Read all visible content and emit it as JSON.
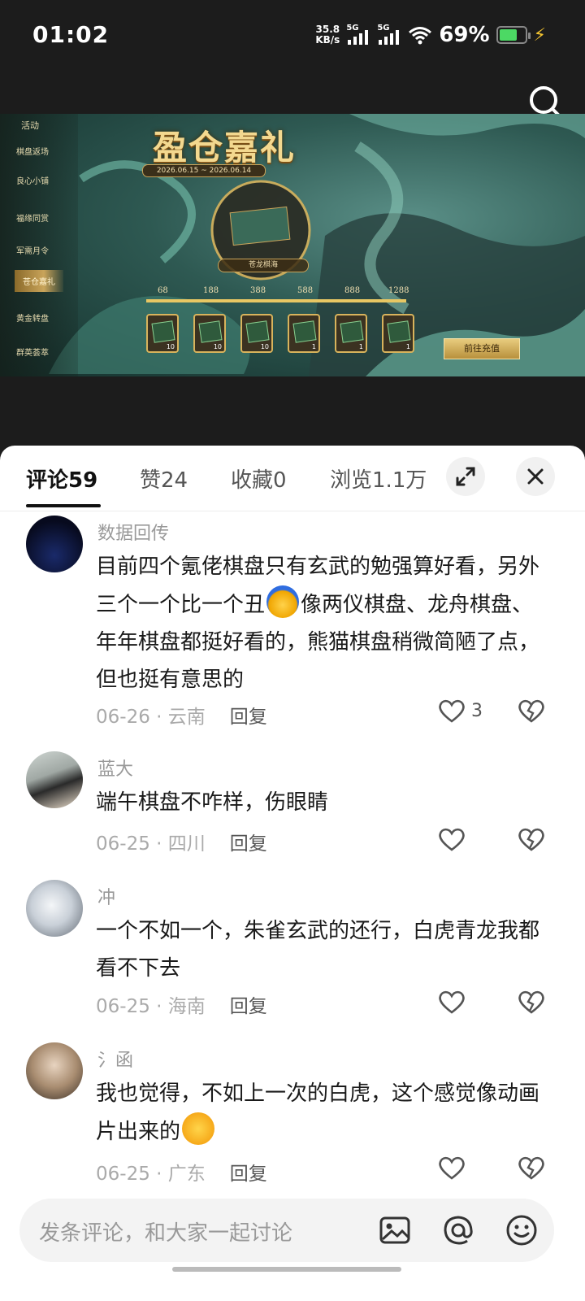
{
  "status_bar": {
    "time": "01:02",
    "net_speed_value": "35.8",
    "net_speed_unit": "KB/s",
    "sim1": "5G",
    "sim2": "5G",
    "battery": "69%",
    "battery_level": 0.69,
    "battery_color": "#4cd964"
  },
  "banner": {
    "menu_title": "活动",
    "menu_items": [
      "棋盘返场",
      "良心小铺",
      "福缘同赏",
      "军需月令",
      "苍仓嘉礼",
      "黄金转盘",
      "群英荟萃"
    ],
    "event_title": "盈仓嘉礼",
    "event_date": "2026.06.15 ~ 2026.06.14",
    "prize_name": "苍龙棋海",
    "milestones": [
      "68",
      "188",
      "388",
      "588",
      "888",
      "1288"
    ],
    "reward_counts": [
      "10",
      "10",
      "10",
      "1",
      "1",
      "1"
    ],
    "recharge_button": "前往充值"
  },
  "tabs": [
    {
      "label": "评论",
      "count": "59"
    },
    {
      "label": "赞",
      "count": "24"
    },
    {
      "label": "收藏",
      "count": "0"
    },
    {
      "label": "浏览",
      "count": "1.1万"
    }
  ],
  "comments": [
    {
      "name": "数据回传",
      "text_a": "目前四个氪佬棋盘只有玄武的勉强算好看，另外三个一个比一个丑",
      "text_b": "像两仪棋盘、龙舟棋盘、年年棋盘都挺好看的，熊猫棋盘稍微简陋了点，但也挺有意思的",
      "date": "06-26",
      "location": "云南",
      "reply": "回复",
      "likes": "3"
    },
    {
      "name": "蓝大",
      "text": "端午棋盘不咋样，伤眼睛",
      "date": "06-25",
      "location": "四川",
      "reply": "回复"
    },
    {
      "name": "冲",
      "text": "一个不如一个，朱雀玄武的还行，白虎青龙我都看不下去",
      "date": "06-25",
      "location": "海南",
      "reply": "回复"
    },
    {
      "name": "氵函",
      "text": "我也觉得，不如上一次的白虎，这个感觉像动画片出来的",
      "date": "06-25",
      "location": "广东",
      "reply": "回复"
    }
  ],
  "input": {
    "placeholder": "发条评论，和大家一起讨论"
  },
  "icons": [
    "search-icon",
    "expand-icon",
    "close-icon",
    "heart-icon",
    "broken-heart-icon",
    "image-icon",
    "at-icon",
    "emoji-icon"
  ]
}
